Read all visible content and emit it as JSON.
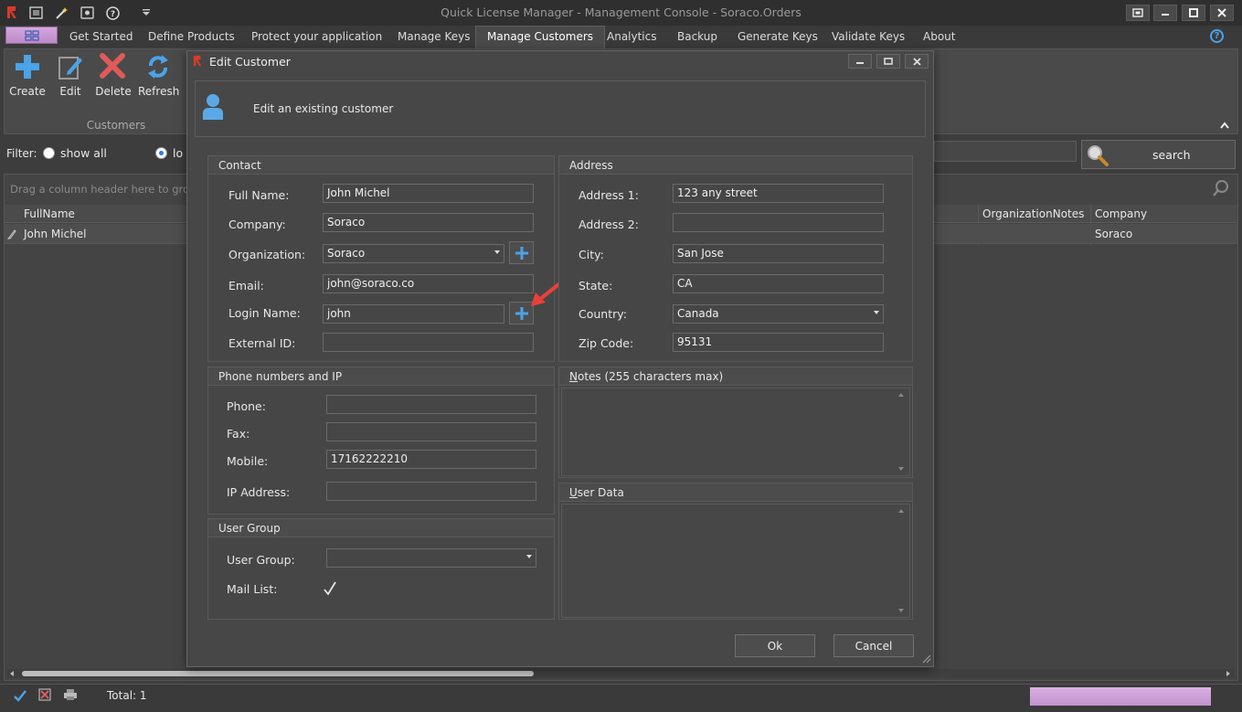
{
  "window": {
    "title": "Quick License Manager - Management Console - Soraco.Orders"
  },
  "tabs": [
    "Get Started",
    "Define Products",
    "Protect your application",
    "Manage Keys",
    "Manage Customers",
    "Analytics",
    "Backup",
    "Generate Keys",
    "Validate Keys",
    "About"
  ],
  "ribbon": {
    "create": "Create",
    "edit": "Edit",
    "delete": "Delete",
    "refresh": "Refresh",
    "group": "Customers"
  },
  "filter": {
    "label": "Filter:",
    "show_all": "show all",
    "lookup": "lo",
    "search": "search"
  },
  "grid": {
    "group_hint": "Drag a column header here to grou",
    "columns": {
      "fullname": "FullName",
      "org_notes": "OrganizationNotes",
      "company": "Company"
    },
    "row": {
      "fullname": "John Michel",
      "company": "Soraco"
    }
  },
  "status": {
    "total": "Total: 1"
  },
  "dialog": {
    "title": "Edit Customer",
    "header": "Edit an existing customer",
    "contact": {
      "title": "Contact",
      "full_name_label": "Full Name:",
      "full_name": "John Michel",
      "company_label": "Company:",
      "company": "Soraco",
      "organization_label": "Organization:",
      "organization": "Soraco",
      "email_label": "Email:",
      "email": "john@soraco.co",
      "login_label": "Login Name:",
      "login": "john",
      "external_label": "External ID:",
      "external": ""
    },
    "address": {
      "title": "Address",
      "address1_label": "Address 1:",
      "address1": "123 any street",
      "address2_label": "Address 2:",
      "address2": "",
      "city_label": "City:",
      "city": "San Jose",
      "state_label": "State:",
      "state": "CA",
      "country_label": "Country:",
      "country": "Canada",
      "zip_label": "Zip Code:",
      "zip": "95131"
    },
    "phone": {
      "title": "Phone numbers and IP",
      "phone_label": "Phone:",
      "phone": "",
      "fax_label": "Fax:",
      "fax": "",
      "mobile_label": "Mobile:",
      "mobile": "17162222210",
      "ip_label": "IP Address:",
      "ip": ""
    },
    "user_group": {
      "title": "User Group",
      "group_label": "User Group:",
      "group": "",
      "mail_label": "Mail List:"
    },
    "notes": {
      "title_first": "N",
      "title_rest": "otes (255 characters max)"
    },
    "user_data": {
      "title_first": "U",
      "title_rest": "ser Data"
    },
    "ok": "Ok",
    "cancel": "Cancel"
  },
  "colors": {
    "accent": "#4ba3e8",
    "delete": "#e05a5a",
    "arrow": "#e8413a",
    "app_button": "#c99ad5"
  }
}
